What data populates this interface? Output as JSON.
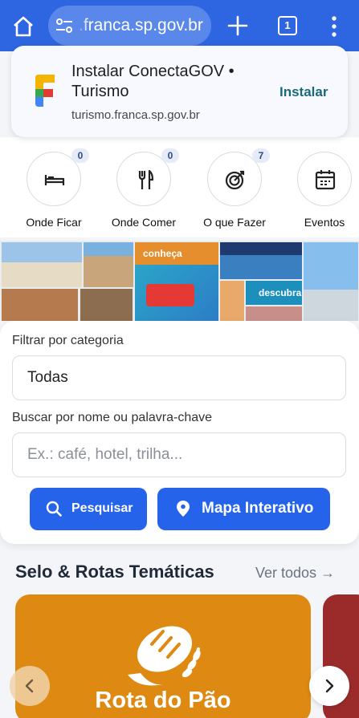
{
  "browser": {
    "url": ".franca.sp.gov.br",
    "tab_count": "1"
  },
  "install_banner": {
    "title": "Instalar ConectaGOV • Turismo",
    "url": "turismo.franca.sp.gov.br",
    "button": "Instalar"
  },
  "categories": [
    {
      "label": "Onde Ficar",
      "count": "0",
      "icon": "bed-icon"
    },
    {
      "label": "Onde Comer",
      "count": "0",
      "icon": "fork-knife-icon"
    },
    {
      "label": "O que Fazer",
      "count": "7",
      "icon": "target-icon"
    },
    {
      "label": "Eventos",
      "icon": "calendar-icon"
    }
  ],
  "hero": {
    "texts": [
      "conheça",
      "descubra"
    ]
  },
  "search": {
    "category_label": "Filtrar por categoria",
    "category_value": "Todas",
    "keyword_label": "Buscar por nome ou palavra-chave",
    "keyword_placeholder": "Ex.: café, hotel, trilha...",
    "search_button": "Pesquisar",
    "map_button": "Mapa Interativo"
  },
  "section": {
    "title": "Selo & Rotas Temáticas",
    "see_all": "Ver todos →"
  },
  "routes": [
    {
      "name": "Rota do Pão",
      "color": "#de8a12"
    }
  ],
  "colors": {
    "browser_bar": "#2d66e0",
    "primary_button": "#2563eb"
  }
}
